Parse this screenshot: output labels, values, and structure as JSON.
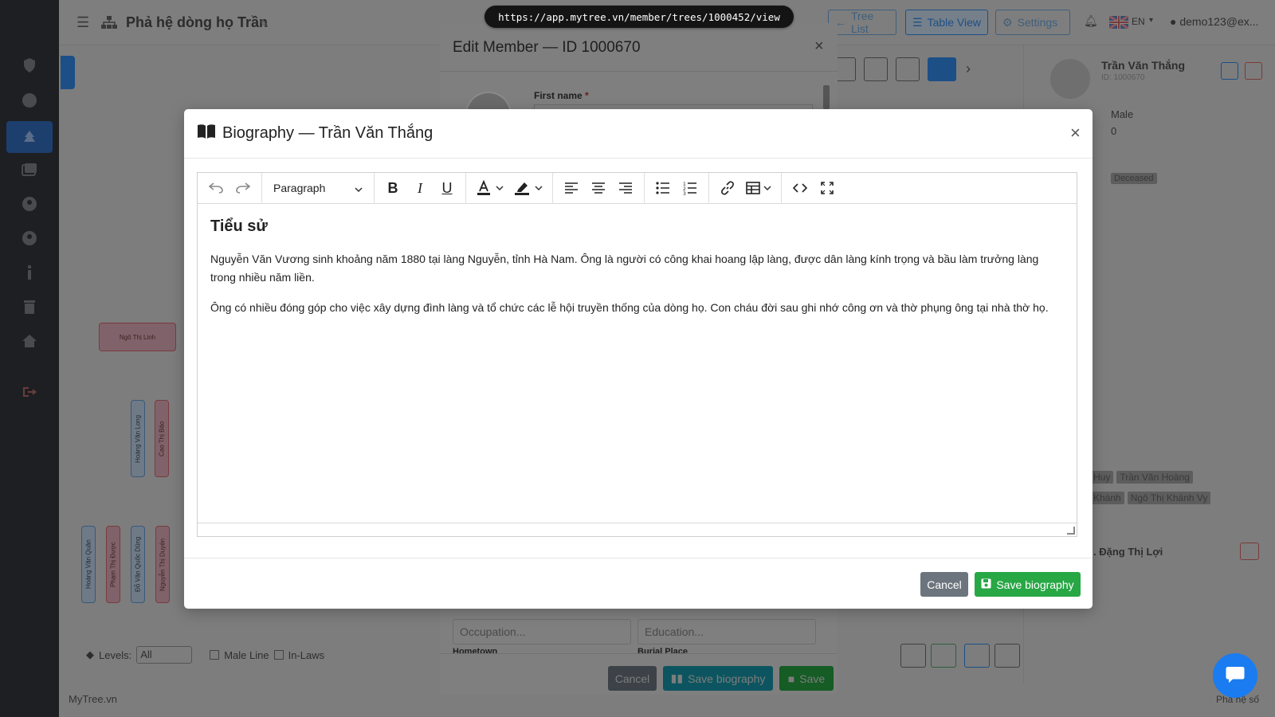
{
  "browser": {
    "url": "https://app.mytree.vn/member/trees/1000452/view"
  },
  "header": {
    "tree_title": "Phả hệ dòng họ Trần",
    "tree_list_label": "Tree List",
    "table_view_label": "Table View",
    "settings_label": "Settings",
    "language": "EN",
    "user": "demo123@ex..."
  },
  "right_panel": {
    "name": "Trần Văn Thắng",
    "id": "ID: 1000670",
    "gender": "Male",
    "value_zero": "0",
    "status": "Deceased",
    "children": [
      "Huy",
      "Trần Văn Hoàng",
      "Khánh",
      "Ngô Thị Khánh Vy"
    ],
    "spouse": ". Đặng Thị Lợi"
  },
  "tree": {
    "node_ngo_thi_linh": "Ngô Thị Linh",
    "node_hoang_van_long": "Hoàng Văn Long",
    "node_cao_thi_bao": "Cao Thị Bảo",
    "node_hoang_van_quan": "Hoàng Văn Quân",
    "node_pham_thi_duoc": "Phạm Thị Được",
    "node_do_van_quoc_dung": "Đỗ Văn Quốc Dũng",
    "node_nguyen_thi_duyen": "Nguyễn Thị Duyên",
    "levels_label": "Levels:",
    "levels_value": "All",
    "male_line_label": "Male Line",
    "in_laws_label": "In-Laws"
  },
  "footer": {
    "brand": "MyTree.vn",
    "right_text": "Phả hệ số"
  },
  "edit_modal": {
    "title": "Edit Member — ID 1000670",
    "first_name_label": "First name",
    "required_mark": "*",
    "occupation_placeholder": "Occupation...",
    "education_placeholder": "Education...",
    "hometown_label": "Hometown",
    "burial_place_label": "Burial Place",
    "cancel_label": "Cancel",
    "save_biography_label": "Save biography",
    "save_label": "Save"
  },
  "bio_modal": {
    "title": "Biography — Trần Văn Thắng",
    "toolbar": {
      "format_label": "Paragraph"
    },
    "content": {
      "heading": "Tiểu sử",
      "paragraph_1": "Nguyễn Văn Vương sinh khoảng năm 1880 tại làng Nguyễn, tỉnh Hà Nam. Ông là người có công khai hoang lập làng, được dân làng kính trọng và bầu làm trưởng làng trong nhiều năm liền.",
      "paragraph_2": "Ông có nhiều đóng góp cho việc xây dựng đình làng và tổ chức các lễ hội truyền thống của dòng họ. Con cháu đời sau ghi nhớ công ơn và thờ phụng ông tại nhà thờ họ."
    },
    "cancel_label": "Cancel",
    "save_label": "Save biography"
  },
  "colors": {
    "brand_blue": "#007bff",
    "save_green": "#28a745",
    "info_teal": "#17a2b8",
    "cancel_grey": "#6c757d",
    "chat_blue": "#1a7cf0"
  }
}
